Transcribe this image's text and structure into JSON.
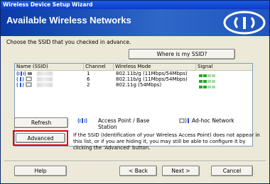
{
  "window": {
    "title": "Wireless Device Setup Wizard"
  },
  "header": {
    "title": "Available Wireless Networks"
  },
  "instruction": "Choose the SSID that you checked in advance.",
  "where_button": "Where is my SSID?",
  "table": {
    "columns": [
      "Name (SSID)",
      "Channel",
      "Wireless Mode",
      "Signal"
    ],
    "rows": [
      {
        "type": "access-point",
        "channel": "1",
        "mode": "802.11b/g (11Mbps/54Mbps)",
        "signal": 0.5
      },
      {
        "type": "ad-hoc",
        "channel": "6",
        "mode": "802.11b/g (11Mbps/54Mbps)",
        "signal": 0.5
      },
      {
        "type": "ad-hoc",
        "channel": "2",
        "mode": "802.11g (54Mbps)",
        "signal": 0.5
      }
    ]
  },
  "refresh_button": "Refresh",
  "legend": {
    "access_point": "Access Point / Base Station",
    "ad_hoc": "Ad-hoc Network"
  },
  "advanced_button": "Advanced",
  "advanced_description": "If the SSID (Identification of your Wireless Access Point) does not appear in this list, or if you are hiding it, you may still be able to configure it by clicking the 'Advanced' button.",
  "footer": {
    "help": "Help",
    "back": "< Back",
    "next": "Next >",
    "cancel": "Cancel"
  },
  "colors": {
    "header_blue": "#1f55bd",
    "highlight_red": "#e00000",
    "signal_green": "#22aa22"
  }
}
